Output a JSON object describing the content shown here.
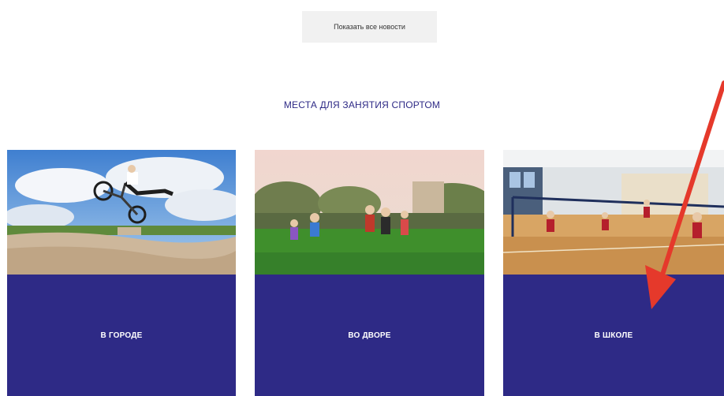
{
  "news": {
    "show_all_label": "Показать все новости"
  },
  "section": {
    "title": "МЕСТА ДЛЯ ЗАНЯТИЯ СПОРТОМ"
  },
  "cards": [
    {
      "label": "В ГОРОДЕ",
      "image": "bmx-rider-skatepark-photo"
    },
    {
      "label": "ВО ДВОРЕ",
      "image": "children-playing-in-yard-photo"
    },
    {
      "label": "В ШКОЛЕ",
      "image": "school-gym-volleyball-photo"
    }
  ],
  "colors": {
    "accent": "#2e2a86",
    "button_bg": "#f1f1f1",
    "annotation_arrow": "#e5392b"
  }
}
